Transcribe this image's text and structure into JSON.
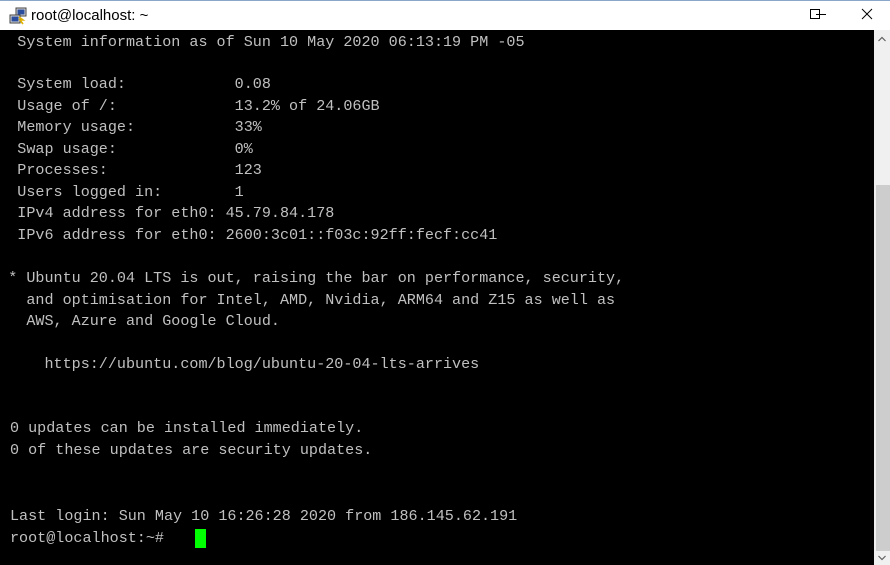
{
  "window": {
    "title": "root@localhost: ~",
    "app_icon": "putty-icon",
    "controls": {
      "minimize_icon": "minimize-icon",
      "maximize_icon": "maximize-icon",
      "close_icon": "close-icon"
    }
  },
  "terminal": {
    "text_color": "#c0c0c0",
    "background": "#000000",
    "cursor_color": "#00ff00",
    "lines": [
      "  System information as of Sun 10 May 2020 06:13:19 PM -05",
      "",
      "  System load:            0.08",
      "  Usage of /:             13.2% of 24.06GB",
      "  Memory usage:           33%",
      "  Swap usage:             0%",
      "  Processes:              123",
      "  Users logged in:        1",
      "  IPv4 address for eth0: 45.79.84.178",
      "  IPv6 address for eth0: 2600:3c01::f03c:92ff:fecf:cc41",
      "",
      " * Ubuntu 20.04 LTS is out, raising the bar on performance, security,",
      "   and optimisation for Intel, AMD, Nvidia, ARM64 and Z15 as well as",
      "   AWS, Azure and Google Cloud.",
      "",
      "     https://ubuntu.com/blog/ubuntu-20-04-lts-arrives",
      "",
      "",
      "0 updates can be installed immediately.",
      "0 of these updates are security updates.",
      "",
      "",
      "Last login: Sun May 10 16:26:28 2020 from 186.145.62.191",
      "root@localhost:~# "
    ]
  }
}
